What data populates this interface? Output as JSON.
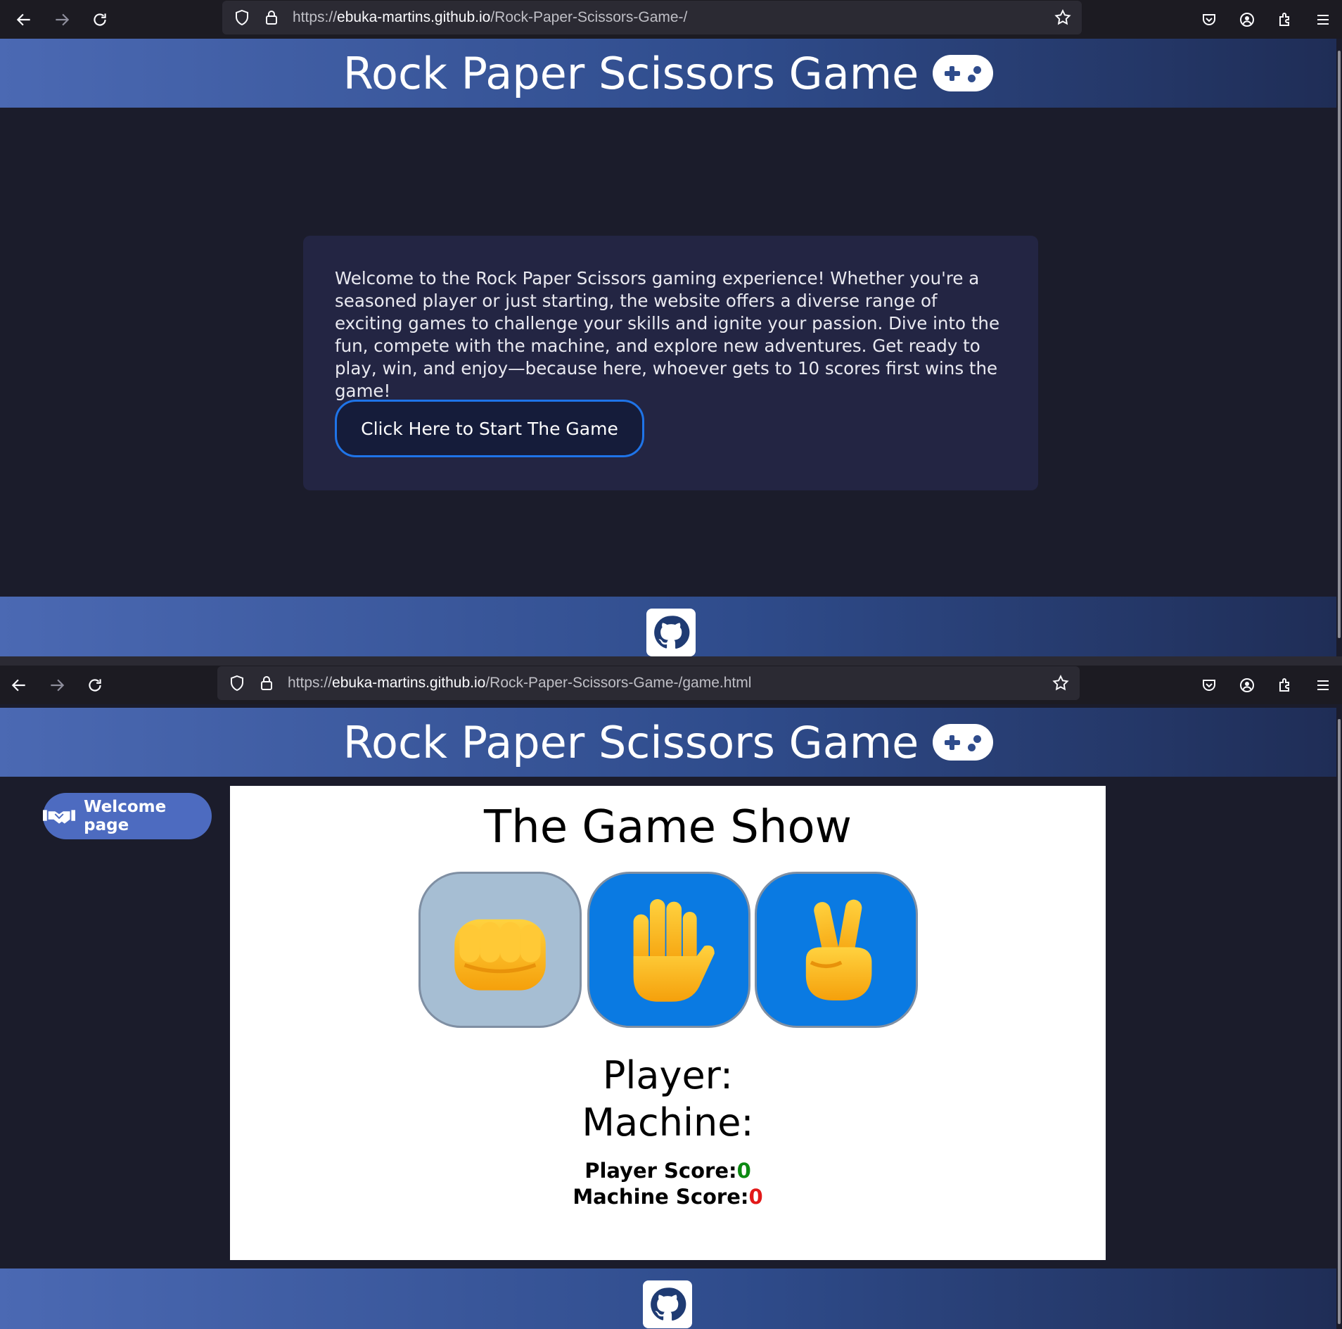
{
  "browser_top": {
    "url_prefix": "https://",
    "url_host": "ebuka-martins.github.io",
    "url_path": "/Rock-Paper-Scissors-Game-/"
  },
  "browser_bottom": {
    "url_prefix": "https://",
    "url_host": "ebuka-martins.github.io",
    "url_path": "/Rock-Paper-Scissors-Game-/game.html"
  },
  "header": {
    "title": "Rock Paper Scissors Game",
    "icon": "gamepad-icon"
  },
  "welcome": {
    "text": "Welcome to the Rock Paper Scissors gaming experience! Whether you're a seasoned player or just starting, the website offers a diverse range of exciting games to challenge your skills and ignite your passion. Dive into the fun, compete with the machine, and explore new adventures. Get ready to play, win, and enjoy—because here, whoever gets to 10 scores first wins the game!",
    "start_button": "Click Here to Start The Game"
  },
  "game": {
    "nav_button": "Welcome page",
    "nav_icon": "handshake-icon",
    "title": "The Game Show",
    "choices": [
      {
        "name": "rock",
        "icon": "fist-icon"
      },
      {
        "name": "paper",
        "icon": "raised-hand-icon"
      },
      {
        "name": "scissors",
        "icon": "victory-hand-icon"
      }
    ],
    "player_label": "Player:",
    "machine_label": "Machine:",
    "player_score_label": "Player Score:",
    "player_score": "0",
    "machine_score_label": "Machine Score:",
    "machine_score": "0"
  },
  "footer": {
    "icon": "github-icon"
  },
  "colors": {
    "page_bg": "#1b1c2b",
    "card_bg": "#232543",
    "accent_blue": "#1f74e8",
    "score_green": "#0c8a12",
    "score_red": "#e21818"
  }
}
